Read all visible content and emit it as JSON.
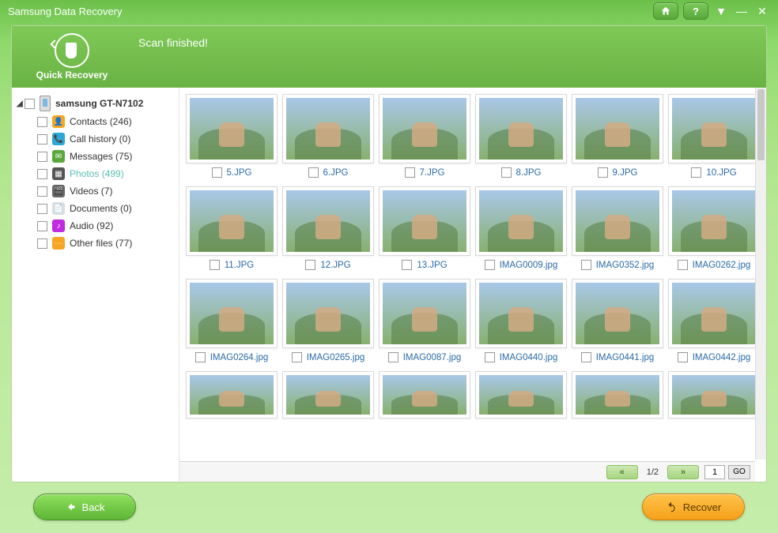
{
  "app": {
    "title": "Samsung Data Recovery"
  },
  "banner": {
    "logo_label": "Quick Recovery",
    "status": "Scan finished!"
  },
  "sidebar": {
    "device": "samsung GT-N7102",
    "items": [
      {
        "label": "Contacts (246)",
        "icon_bg": "#f6a623",
        "glyph": "👤"
      },
      {
        "label": "Call history (0)",
        "icon_bg": "#2aa8d8",
        "glyph": "📞"
      },
      {
        "label": "Messages (75)",
        "icon_bg": "#5aa83c",
        "glyph": "✉"
      },
      {
        "label": "Photos (499)",
        "icon_bg": "#555555",
        "glyph": "▦",
        "selected": true
      },
      {
        "label": "Videos (7)",
        "icon_bg": "#666666",
        "glyph": "🎬"
      },
      {
        "label": "Documents (0)",
        "icon_bg": "#dddddd",
        "glyph": "📄"
      },
      {
        "label": "Audio (92)",
        "icon_bg": "#c02ae0",
        "glyph": "♪"
      },
      {
        "label": "Other files (77)",
        "icon_bg": "#f6a623",
        "glyph": "⋯"
      }
    ]
  },
  "grid": {
    "items": [
      "5.JPG",
      "6.JPG",
      "7.JPG",
      "8.JPG",
      "9.JPG",
      "10.JPG",
      "11.JPG",
      "12.JPG",
      "13.JPG",
      "IMAG0009.jpg",
      "IMAG0352.jpg",
      "IMAG0262.jpg",
      "IMAG0264.jpg",
      "IMAG0265.jpg",
      "IMAG0087.jpg",
      "IMAG0440.jpg",
      "IMAG0441.jpg",
      "IMAG0442.jpg"
    ]
  },
  "pager": {
    "prev": "«",
    "next": "»",
    "status": "1/2",
    "input_value": "1",
    "go": "GO"
  },
  "footer": {
    "back": "Back",
    "recover": "Recover"
  }
}
